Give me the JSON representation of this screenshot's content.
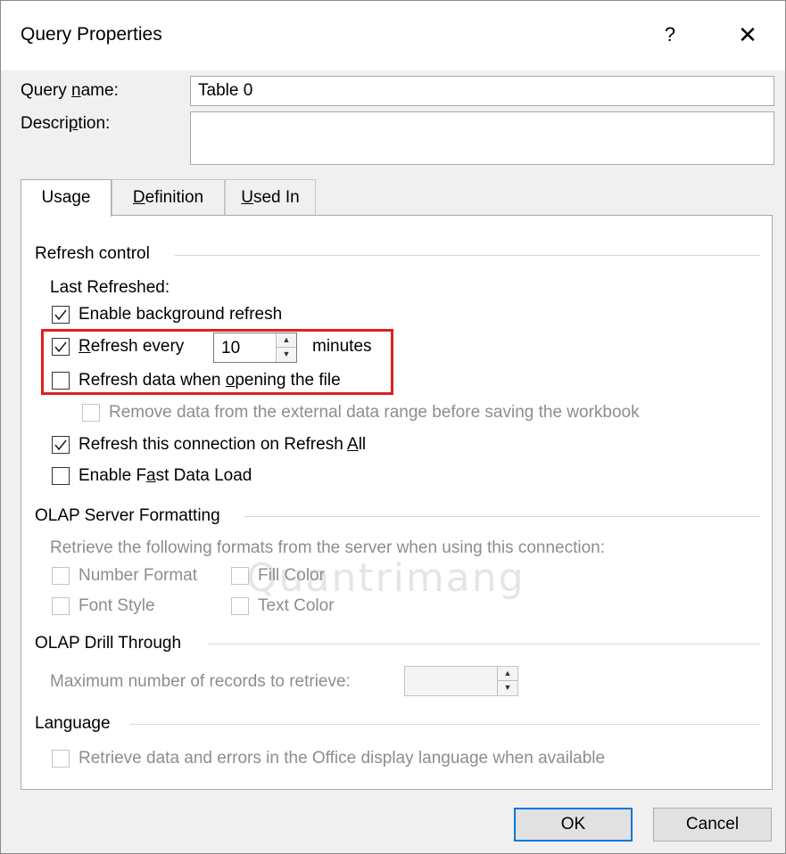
{
  "dialog": {
    "title": "Query Properties",
    "help_label": "?",
    "close_label": "✕"
  },
  "query_name": {
    "label": "Query ",
    "label_u": "n",
    "label_rest": "ame:",
    "value": "Table 0"
  },
  "description": {
    "label": "Descri",
    "label_u": "p",
    "label_rest": "tion:",
    "value": ""
  },
  "tabs": [
    {
      "pre": "Usa",
      "u": "g",
      "post": "e"
    },
    {
      "pre": "",
      "u": "D",
      "post": "efinition"
    },
    {
      "pre": "",
      "u": "U",
      "post": "sed In"
    }
  ],
  "refresh_control": {
    "header": "Refresh control",
    "last_refreshed": "Last Refreshed:",
    "enable_background": "Enable background refresh",
    "refresh_every_u": "R",
    "refresh_every_rest": "efresh every",
    "refresh_minutes_value": "10",
    "minutes_label": "minutes",
    "refresh_on_open_pre": "Refresh data when ",
    "refresh_on_open_u": "o",
    "refresh_on_open_post": "pening the file",
    "remove_data": "Remove data from the external data range before saving the workbook",
    "refresh_all_pre": "Refresh this connection on Refresh ",
    "refresh_all_u": "A",
    "refresh_all_post": "ll",
    "fast_load_pre": "Enable F",
    "fast_load_u": "a",
    "fast_load_post": "st Data Load"
  },
  "olap_formatting": {
    "header": "OLAP Server Formatting",
    "desc": "Retrieve the following formats from the server when using this connection:",
    "number_format": "Number Format",
    "fill_color": "Fill Color",
    "font_style": "Font Style",
    "text_color": "Text Color"
  },
  "olap_drill": {
    "header": "OLAP Drill Through",
    "max_records": "Maximum number of records to retrieve:",
    "max_records_value": ""
  },
  "language": {
    "header": "Language",
    "retrieve": "Retrieve data and errors in the Office display language when available"
  },
  "buttons": {
    "ok": "OK",
    "cancel": "Cancel"
  },
  "watermark": "Quantrimang"
}
